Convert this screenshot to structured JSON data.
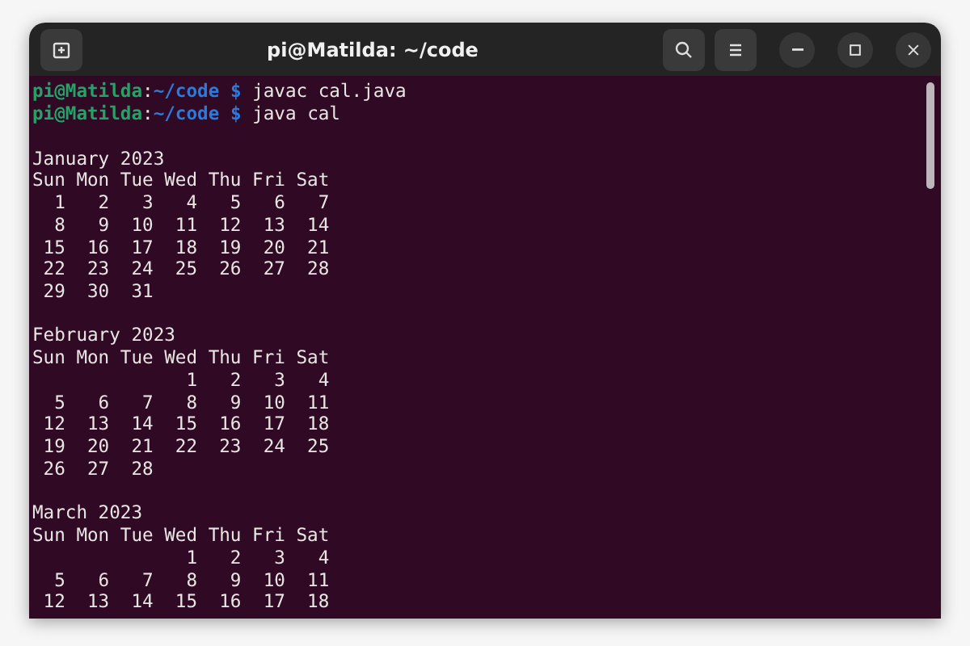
{
  "window": {
    "title": "pi@Matilda: ~/code"
  },
  "terminal": {
    "lines": [
      {
        "kind": "prompt",
        "user": "pi@Matilda",
        "separator": ":",
        "path": "~/code",
        "symbol": "$",
        "command": "javac cal.java"
      },
      {
        "kind": "prompt",
        "user": "pi@Matilda",
        "separator": ":",
        "path": "~/code",
        "symbol": "$",
        "command": "java cal"
      },
      {
        "kind": "blank"
      },
      {
        "kind": "output",
        "text": "January 2023"
      },
      {
        "kind": "output",
        "text": "Sun Mon Tue Wed Thu Fri Sat"
      },
      {
        "kind": "output",
        "text": "  1   2   3   4   5   6   7"
      },
      {
        "kind": "output",
        "text": "  8   9  10  11  12  13  14"
      },
      {
        "kind": "output",
        "text": " 15  16  17  18  19  20  21"
      },
      {
        "kind": "output",
        "text": " 22  23  24  25  26  27  28"
      },
      {
        "kind": "output",
        "text": " 29  30  31"
      },
      {
        "kind": "blank"
      },
      {
        "kind": "output",
        "text": "February 2023"
      },
      {
        "kind": "output",
        "text": "Sun Mon Tue Wed Thu Fri Sat"
      },
      {
        "kind": "output",
        "text": "              1   2   3   4"
      },
      {
        "kind": "output",
        "text": "  5   6   7   8   9  10  11"
      },
      {
        "kind": "output",
        "text": " 12  13  14  15  16  17  18"
      },
      {
        "kind": "output",
        "text": " 19  20  21  22  23  24  25"
      },
      {
        "kind": "output",
        "text": " 26  27  28"
      },
      {
        "kind": "blank"
      },
      {
        "kind": "output",
        "text": "March 2023"
      },
      {
        "kind": "output",
        "text": "Sun Mon Tue Wed Thu Fri Sat"
      },
      {
        "kind": "output",
        "text": "              1   2   3   4"
      },
      {
        "kind": "output",
        "text": "  5   6   7   8   9  10  11"
      },
      {
        "kind": "output",
        "text": " 12  13  14  15  16  17  18"
      }
    ]
  }
}
